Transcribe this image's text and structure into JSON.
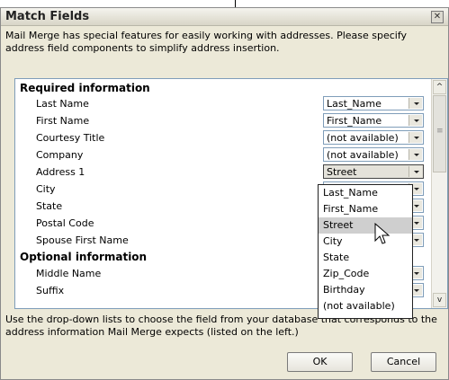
{
  "dialog": {
    "title": "Match Fields",
    "close_glyph": "✕",
    "intro": "Mail Merge has special features for easily working with addresses.  Please specify address field components to simplify address insertion.",
    "help": "Use the drop-down lists to choose the field from your database that corresponds to the address information Mail Merge expects (listed on the left.)"
  },
  "required": {
    "heading": "Required information",
    "fields": [
      {
        "label": "Last Name",
        "value": "Last_Name"
      },
      {
        "label": "First Name",
        "value": "First_Name"
      },
      {
        "label": "Courtesy Title",
        "value": "(not available)"
      },
      {
        "label": "Company",
        "value": "(not available)"
      },
      {
        "label": "Address 1",
        "value": "Street"
      },
      {
        "label": "City",
        "value": ""
      },
      {
        "label": "State",
        "value": ""
      },
      {
        "label": "Postal Code",
        "value": ""
      },
      {
        "label": "Spouse First Name",
        "value": ""
      }
    ]
  },
  "optional": {
    "heading": "Optional information",
    "fields": [
      {
        "label": "Middle Name",
        "value": ""
      },
      {
        "label": "Suffix",
        "value": ""
      }
    ]
  },
  "dropdown_options": [
    "Last_Name",
    "First_Name",
    "Street",
    "City",
    "State",
    "Zip_Code",
    "Birthday",
    "(not available)"
  ],
  "dropdown_highlighted": "Street",
  "scroll": {
    "up_glyph": "^",
    "down_glyph": "v"
  },
  "buttons": {
    "ok": "OK",
    "cancel": "Cancel"
  },
  "icons": {
    "close": "close-icon",
    "cursor": "arrow-cursor-icon",
    "dropdown_arrow": "chevron-down-icon"
  }
}
